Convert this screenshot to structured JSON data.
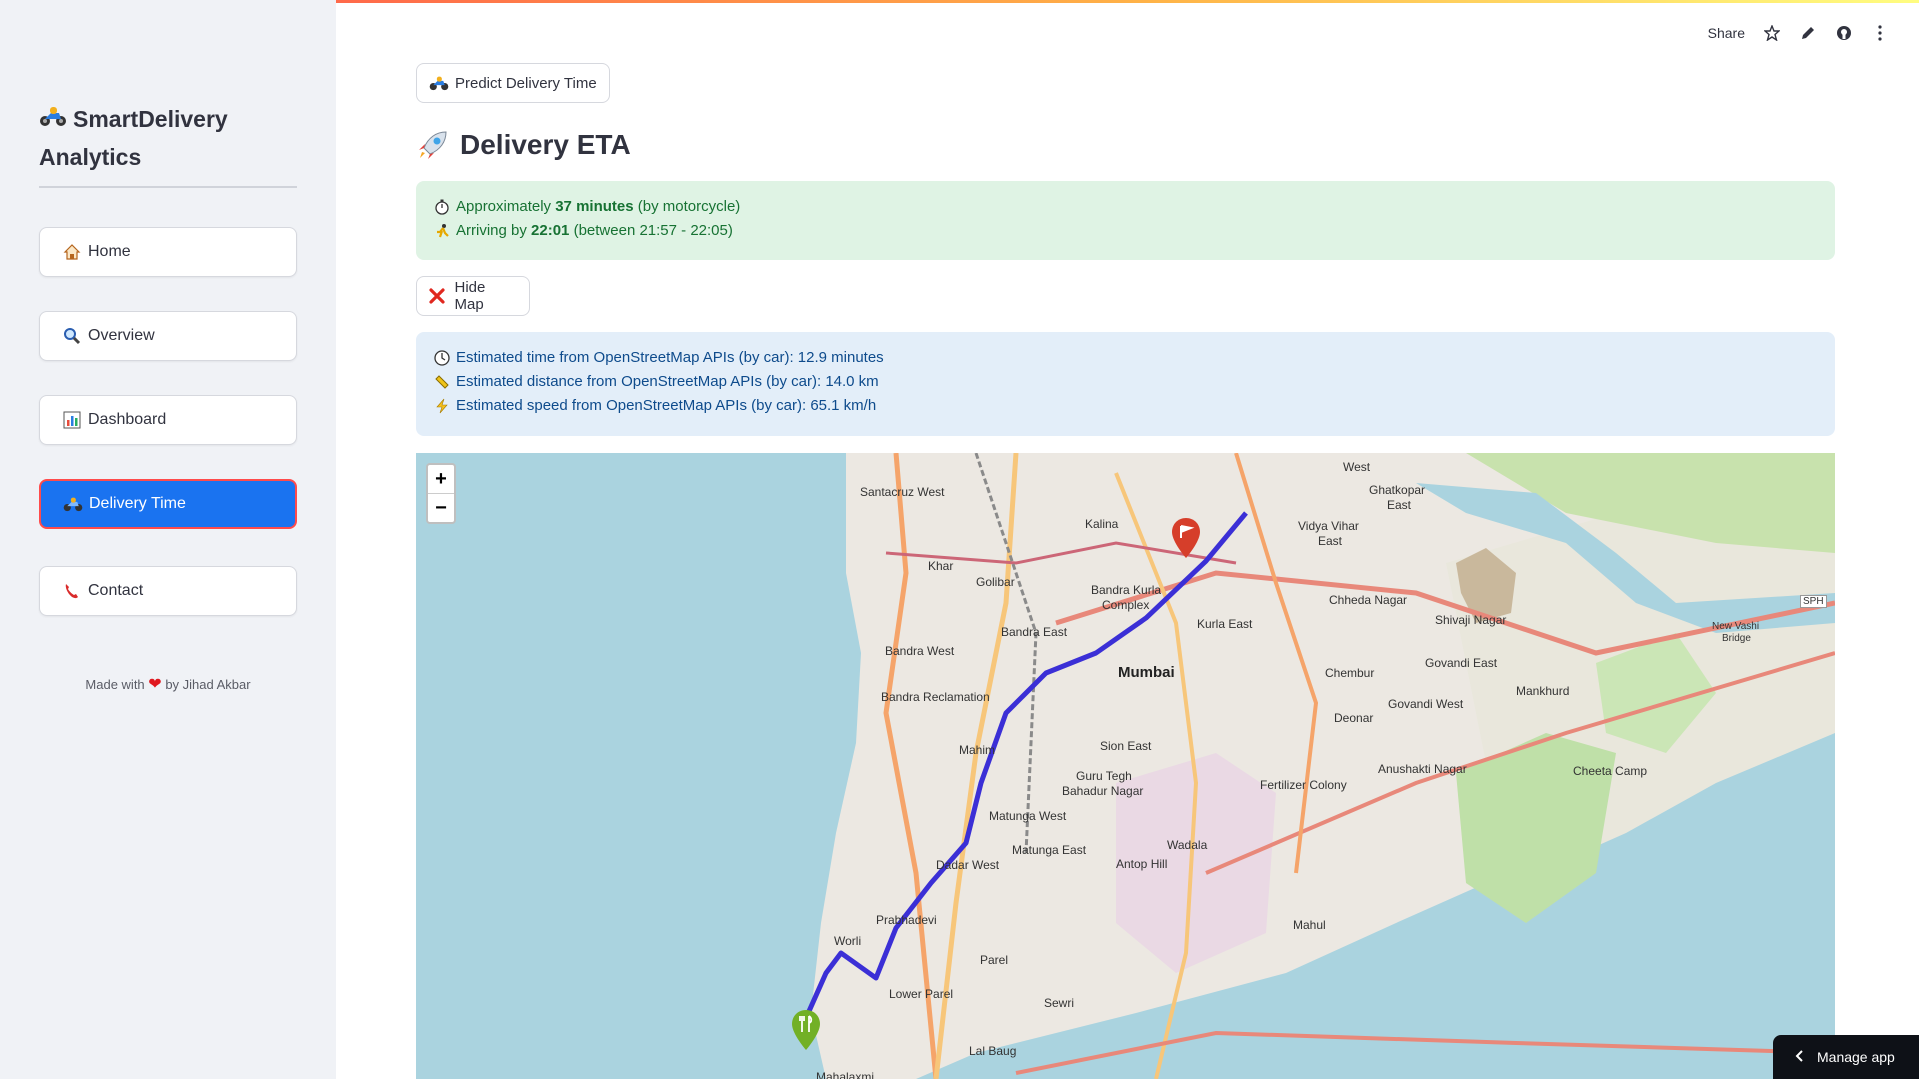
{
  "sidebar": {
    "brand_line1": "SmartDelivery",
    "brand_line2": "Analytics",
    "items": [
      {
        "label": "Home",
        "icon": "house-icon"
      },
      {
        "label": "Overview",
        "icon": "magnifier-icon"
      },
      {
        "label": "Dashboard",
        "icon": "bar-chart-icon"
      },
      {
        "label": "Delivery Time",
        "icon": "motorcycle-icon",
        "active": true
      },
      {
        "label": "Contact",
        "icon": "phone-icon"
      }
    ],
    "footer_prefix": "Made with",
    "footer_suffix": "by Jihad Akbar"
  },
  "header": {
    "share_label": "Share"
  },
  "main": {
    "predict_button": "Predict Delivery Time",
    "title": "Delivery ETA",
    "success": {
      "line1_prefix": "Approximately",
      "line1_bold": "37 minutes",
      "line1_suffix": "(by motorcycle)",
      "line2_prefix": "Arriving by",
      "line2_bold": "22:01",
      "line2_suffix": "(between 21:57 - 22:05)"
    },
    "hide_map_button": "Hide Map",
    "info": {
      "time": "Estimated time from OpenStreetMap APIs (by car): 12.9 minutes",
      "distance": "Estimated distance from OpenStreetMap APIs (by car): 14.0 km",
      "speed": "Estimated speed from OpenStreetMap APIs (by car): 65.1 km/h"
    }
  },
  "map": {
    "zoom_in": "+",
    "zoom_out": "−",
    "labels": {
      "santacruz": "Santacruz West",
      "kalina": "Kalina",
      "khar": "Khar",
      "golibar": "Golibar",
      "bkc": "Bandra Kurla",
      "bkc2": "Complex",
      "bandra_east": "Bandra East",
      "bandra_west": "Bandra West",
      "bandra_recl": "Bandra Reclamation",
      "mumbai": "Mumbai",
      "kurla_east": "Kurla East",
      "chembur": "Chembur",
      "ghatkopar": "Ghatkopar",
      "ghatkopar_east": "East",
      "ghatkopar_west": "West",
      "vidyavihar": "Vidya Vihar",
      "vidyavihar2": "East",
      "cheda": "Chheda Nagar",
      "shivaji": "Shivaji Nagar",
      "govandi_east": "Govandi East",
      "govandi_west": "Govandi West",
      "mankhurd": "Mankhurd",
      "deonar": "Deonar",
      "mahim": "Mahim",
      "sion": "Sion East",
      "guru": "Guru Tegh",
      "guru2": "Bahadur Nagar",
      "fertilizer": "Fertilizer Colony",
      "anushakti": "Anushakti Nagar",
      "cheeta": "Cheeta Camp",
      "matunga_w": "Matunga West",
      "matunga_e": "Matunga East",
      "wadala": "Wadala",
      "dadar": "Dadar West",
      "antop": "Antop Hill",
      "prabhadevi": "Prabhadevi",
      "worli": "Worli",
      "mahul": "Mahul",
      "parel": "Parel",
      "lowerparel": "Lower Parel",
      "sewri": "Sewri",
      "lalbaug": "Lal Baug",
      "mahalaxmi": "Mahalaxmi",
      "vashi": "New Vashi",
      "vashi2": "Bridge",
      "sph": "SPH"
    }
  },
  "manage_app": "Manage app",
  "colors": {
    "accent_blue": "#1a73f0",
    "route": "#3b2fd6",
    "water": "#aad3df",
    "success_bg": "#dff3e4",
    "info_bg": "#e3eef9"
  }
}
